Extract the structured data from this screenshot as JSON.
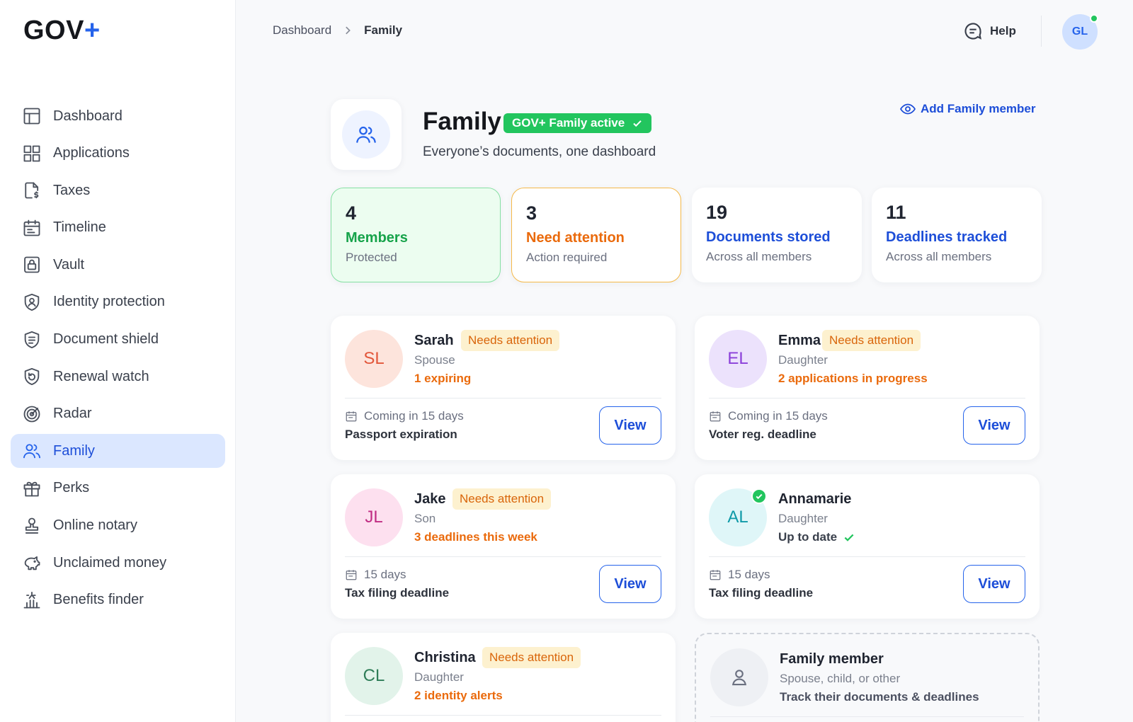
{
  "logo": {
    "text": "GOV",
    "plus": "+"
  },
  "sidebar": {
    "items": [
      {
        "label": "Dashboard",
        "icon": "dashboard-icon"
      },
      {
        "label": "Applications",
        "icon": "grid-icon"
      },
      {
        "label": "Taxes",
        "icon": "tax-document-icon"
      },
      {
        "label": "Timeline",
        "icon": "calendar-icon"
      },
      {
        "label": "Vault",
        "icon": "lock-icon"
      },
      {
        "label": "Identity protection",
        "icon": "shield-user-icon"
      },
      {
        "label": "Document shield",
        "icon": "shield-lines-icon"
      },
      {
        "label": "Renewal watch",
        "icon": "shield-refresh-icon"
      },
      {
        "label": "Radar",
        "icon": "radar-icon"
      },
      {
        "label": "Family",
        "icon": "users-icon",
        "active": true
      },
      {
        "label": "Perks",
        "icon": "gift-icon"
      },
      {
        "label": "Online notary",
        "icon": "stamp-icon"
      },
      {
        "label": "Unclaimed money",
        "icon": "piggy-bank-icon"
      },
      {
        "label": "Benefits finder",
        "icon": "benefits-icon"
      }
    ]
  },
  "breadcrumb": {
    "root": "Dashboard",
    "current": "Family"
  },
  "topbar": {
    "help_label": "Help",
    "avatar_initials": "GL"
  },
  "header": {
    "title": "Family",
    "badge": "GOV+ Family active",
    "subtitle": "Everyone’s documents, one dashboard",
    "add_member_label": "Add Family member"
  },
  "stats": [
    {
      "value": "4",
      "title": "Members",
      "sub": "Protected"
    },
    {
      "value": "3",
      "title": "Need attention",
      "sub": "Action required"
    },
    {
      "value": "19",
      "title": "Documents stored",
      "sub": "Across all members"
    },
    {
      "value": "11",
      "title": "Deadlines tracked",
      "sub": "Across all members"
    }
  ],
  "members": [
    {
      "initials": "SL",
      "name": "Sarah",
      "tag": "Needs attention",
      "role": "Spouse",
      "note": "1 expiring",
      "when": "Coming in 15 days",
      "what": "Passport expiration",
      "view": "View"
    },
    {
      "initials": "EL",
      "name": "Emma",
      "tag": "Needs attention",
      "role": "Daughter",
      "note": "2 applications in progress",
      "when": "Coming in 15 days",
      "what": "Voter reg. deadline",
      "view": "View"
    },
    {
      "initials": "JL",
      "name": "Jake",
      "tag": "Needs attention",
      "role": "Son",
      "note": "3 deadlines this week",
      "when": "15 days",
      "what": "Tax filing deadline",
      "view": "View"
    },
    {
      "initials": "AL",
      "name": "Annamarie",
      "role": "Daughter",
      "note": "Up to date",
      "when": "15 days",
      "what": "Tax filing deadline",
      "view": "View"
    },
    {
      "initials": "CL",
      "name": "Christina",
      "tag": "Needs attention",
      "role": "Daughter",
      "note": "2 identity alerts"
    }
  ],
  "add_card": {
    "title": "Family member",
    "sub": "Spouse, child, or other",
    "sub2": "Track their documents & deadlines"
  },
  "colors": {
    "accent": "#2563eb",
    "success": "#22c55e",
    "warning": "#ea6a0c",
    "active_nav_bg": "#dbe7ff"
  }
}
